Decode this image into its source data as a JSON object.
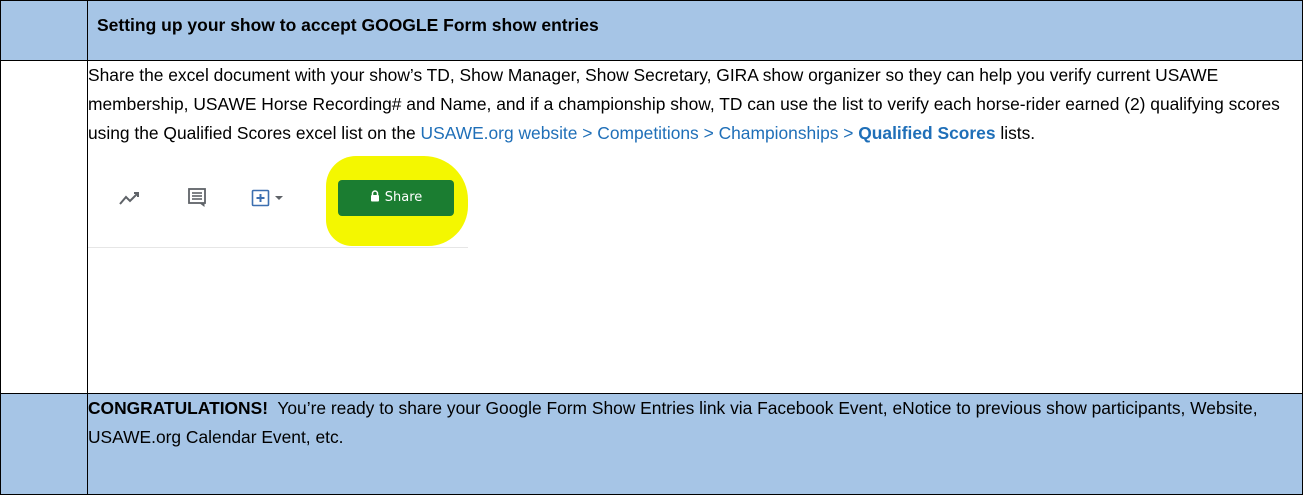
{
  "header": {
    "title": "Setting up your show to accept GOOGLE Form show entries"
  },
  "body": {
    "paragraph_intro": "Share the excel document with your show’s TD, Show Manager, Show Secretary, GIRA show organizer so they can help you verify current USAWE membership, USAWE Horse Recording# and Name, and if a championship show, TD can use the list to verify each horse-rider earned (2) qualifying scores using the Qualified Scores excel list on the ",
    "link_path": "USAWE.org website > Competitions > Championships > ",
    "link_bold": "Qualified Scores",
    "paragraph_end": " lists."
  },
  "toolbar": {
    "icons": [
      "trend-icon",
      "comment-icon",
      "present-icon",
      "chevron-down-icon",
      "lock-icon"
    ],
    "share_label": "Share",
    "accent_color": "#1b7d31",
    "highlight_color": "#f4f700"
  },
  "footer": {
    "bold_text": "CONGRATULATIONS!",
    "text": "  You’re ready to share your Google Form Show Entries link via Facebook Event, eNotice to previous show participants, Website, USAWE.org Calendar Event, etc."
  },
  "colors": {
    "row_shade": "#a6c5e6",
    "link": "#1f6fb8"
  }
}
